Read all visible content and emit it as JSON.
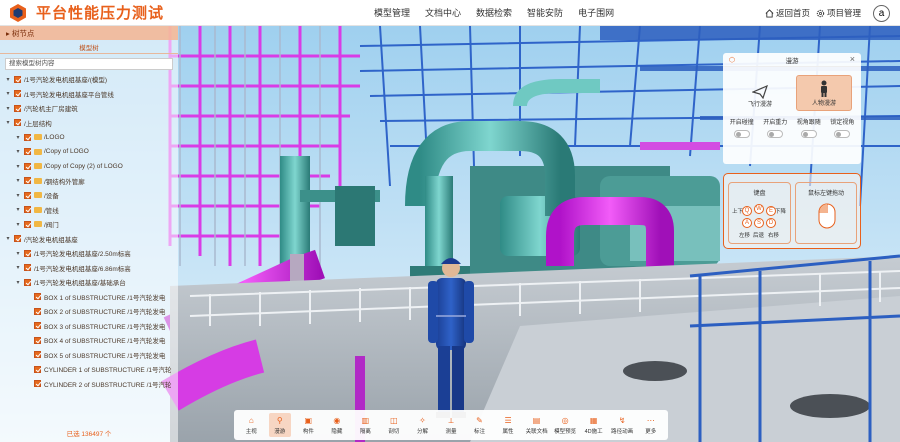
{
  "header": {
    "title": "平台性能压力测试",
    "nav": [
      "模型管理",
      "文档中心",
      "数据检索",
      "智能安防",
      "电子围网"
    ],
    "back_label": "返回首页",
    "project_label": "项目管理",
    "avatar_letter": "a"
  },
  "left_panel": {
    "header_label": "▸ 树节点",
    "tab_label": "模型树",
    "search_placeholder": "搜索模型树内容",
    "tree": [
      {
        "label": "/1号汽轮发电机组基座/(模型)",
        "level": 1,
        "folder": false
      },
      {
        "label": "/1号汽轮发电机组基座平台管线",
        "level": 1,
        "folder": false
      },
      {
        "label": "/汽轮机主厂房建筑",
        "level": 1,
        "folder": false
      },
      {
        "label": "/上层结构",
        "level": 1,
        "folder": false
      },
      {
        "label": "/LOGO",
        "level": 2,
        "folder": true
      },
      {
        "label": "/Copy of LOGO",
        "level": 2,
        "folder": true
      },
      {
        "label": "/Copy of Copy (2) of LOGO",
        "level": 2,
        "folder": true
      },
      {
        "label": "/钢结构外管廊",
        "level": 2,
        "folder": true
      },
      {
        "label": "/设备",
        "level": 2,
        "folder": true
      },
      {
        "label": "/管线",
        "level": 2,
        "folder": true
      },
      {
        "label": "/阀门",
        "level": 2,
        "folder": true
      },
      {
        "label": "/汽轮发电机组基座",
        "level": 1,
        "folder": false
      },
      {
        "label": "/1号汽轮发电机组基座/2.50m标高",
        "level": 2,
        "folder": false
      },
      {
        "label": "/1号汽轮发电机组基座/6.86m标高",
        "level": 2,
        "folder": false
      },
      {
        "label": "/1号汽轮发电机组基座/基础承台",
        "level": 2,
        "folder": false
      },
      {
        "label": "BOX 1 of SUBSTRUCTURE /1号汽轮发电",
        "level": 3,
        "folder": false
      },
      {
        "label": "BOX 2 of SUBSTRUCTURE /1号汽轮发电",
        "level": 3,
        "folder": false
      },
      {
        "label": "BOX 3 of SUBSTRUCTURE /1号汽轮发电",
        "level": 3,
        "folder": false
      },
      {
        "label": "BOX 4 of SUBSTRUCTURE /1号汽轮发电",
        "level": 3,
        "folder": false
      },
      {
        "label": "BOX 5 of SUBSTRUCTURE /1号汽轮发电",
        "level": 3,
        "folder": false
      },
      {
        "label": "CYLINDER 1 of SUBSTRUCTURE /1号汽轮",
        "level": 3,
        "folder": false
      },
      {
        "label": "CYLINDER 2 of SUBSTRUCTURE /1号汽轮",
        "level": 3,
        "folder": false
      }
    ],
    "footer": "已选 136497 个"
  },
  "roam": {
    "title": "漫游",
    "modes": [
      "飞行漫游",
      "人物漫游"
    ],
    "options": [
      {
        "label": "开启碰撞",
        "state": "关"
      },
      {
        "label": "开启重力",
        "state": "关"
      },
      {
        "label": "视角跟随",
        "state": "关"
      },
      {
        "label": "锁定视角",
        "state": "关"
      }
    ]
  },
  "controls": {
    "keyboard_title": "键盘",
    "keys": [
      "Q",
      "W",
      "E",
      "A",
      "S",
      "D"
    ],
    "left_label": "上下",
    "right_label": "下降",
    "a_label": "左移",
    "s_label": "后退",
    "d_label": "右移",
    "mouse_title": "鼠标左键拖动"
  },
  "toolbar": [
    {
      "label": "主视",
      "icon": "home-icon"
    },
    {
      "label": "漫游",
      "icon": "walk-icon",
      "active": true
    },
    {
      "label": "构件",
      "icon": "cube-icon"
    },
    {
      "label": "隐藏",
      "icon": "eye-icon"
    },
    {
      "label": "隔离",
      "icon": "isolate-icon"
    },
    {
      "label": "剖切",
      "icon": "section-icon"
    },
    {
      "label": "分解",
      "icon": "explode-icon"
    },
    {
      "label": "测量",
      "icon": "measure-icon"
    },
    {
      "label": "标注",
      "icon": "markup-icon"
    },
    {
      "label": "属性",
      "icon": "property-icon"
    },
    {
      "label": "关联文档",
      "icon": "doc-icon"
    },
    {
      "label": "模型预览",
      "icon": "preview-icon"
    },
    {
      "label": "4D施工",
      "icon": "timeline-icon"
    },
    {
      "label": "路径动画",
      "icon": "path-icon"
    },
    {
      "label": "更多",
      "icon": "more-icon"
    }
  ]
}
